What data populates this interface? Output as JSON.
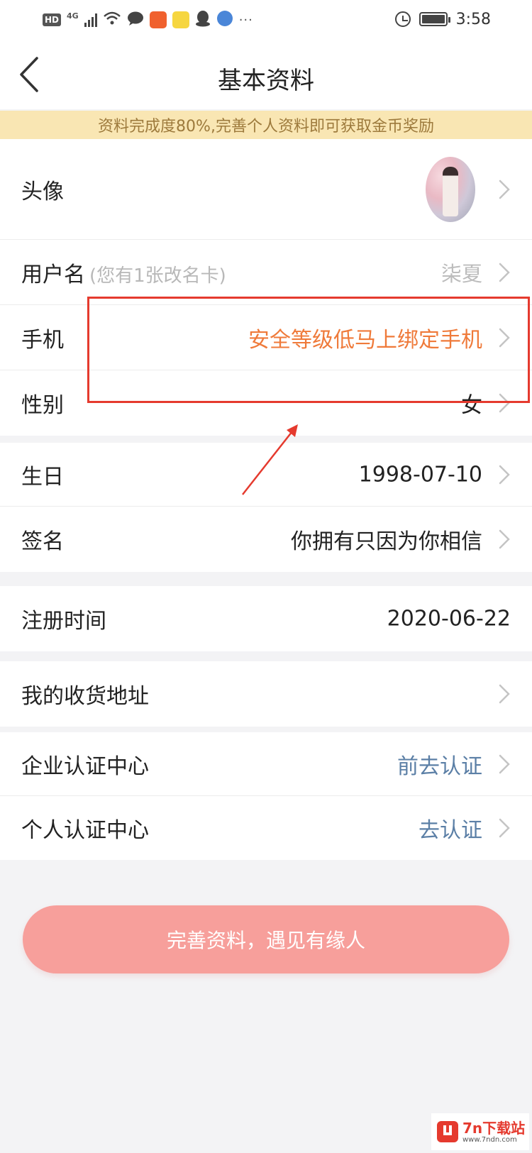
{
  "status_bar": {
    "hd_label": "HD",
    "network_label": "4G",
    "time": "3:58",
    "overflow_dots": "···"
  },
  "header": {
    "title": "基本资料"
  },
  "banner": {
    "text": "资料完成度80%,完善个人资料即可获取金币奖励"
  },
  "profile": {
    "avatar_label": "头像",
    "username_label": "用户名",
    "username_hint": "(您有1张改名卡)",
    "username_value": "柒夏",
    "phone_label": "手机",
    "phone_value": "安全等级低马上绑定手机",
    "gender_label": "性别",
    "gender_value": "女",
    "birthday_label": "生日",
    "birthday_value": "1998-07-10",
    "signature_label": "签名",
    "signature_value": "你拥有只因为你相信",
    "register_label": "注册时间",
    "register_value": "2020-06-22",
    "address_label": "我的收货地址",
    "enterprise_label": "企业认证中心",
    "enterprise_value": "前去认证",
    "personal_label": "个人认证中心",
    "personal_value": "去认证"
  },
  "cta": {
    "label": "完善资料，遇见有缘人"
  },
  "watermark": {
    "main": "7n下载站",
    "sub": "www.7ndn.com"
  },
  "colors": {
    "banner_bg": "#f9e6b3",
    "banner_text": "#9d7a3c",
    "warning_text": "#ef7a3a",
    "link_text": "#5b7fa6",
    "cta_bg": "#f79f9b",
    "annotation_red": "#e53a2e"
  },
  "icons": {
    "back": "back-chevron-icon",
    "row_arrow": "chevron-right-icon",
    "alarm": "alarm-clock-icon",
    "battery": "battery-icon"
  }
}
